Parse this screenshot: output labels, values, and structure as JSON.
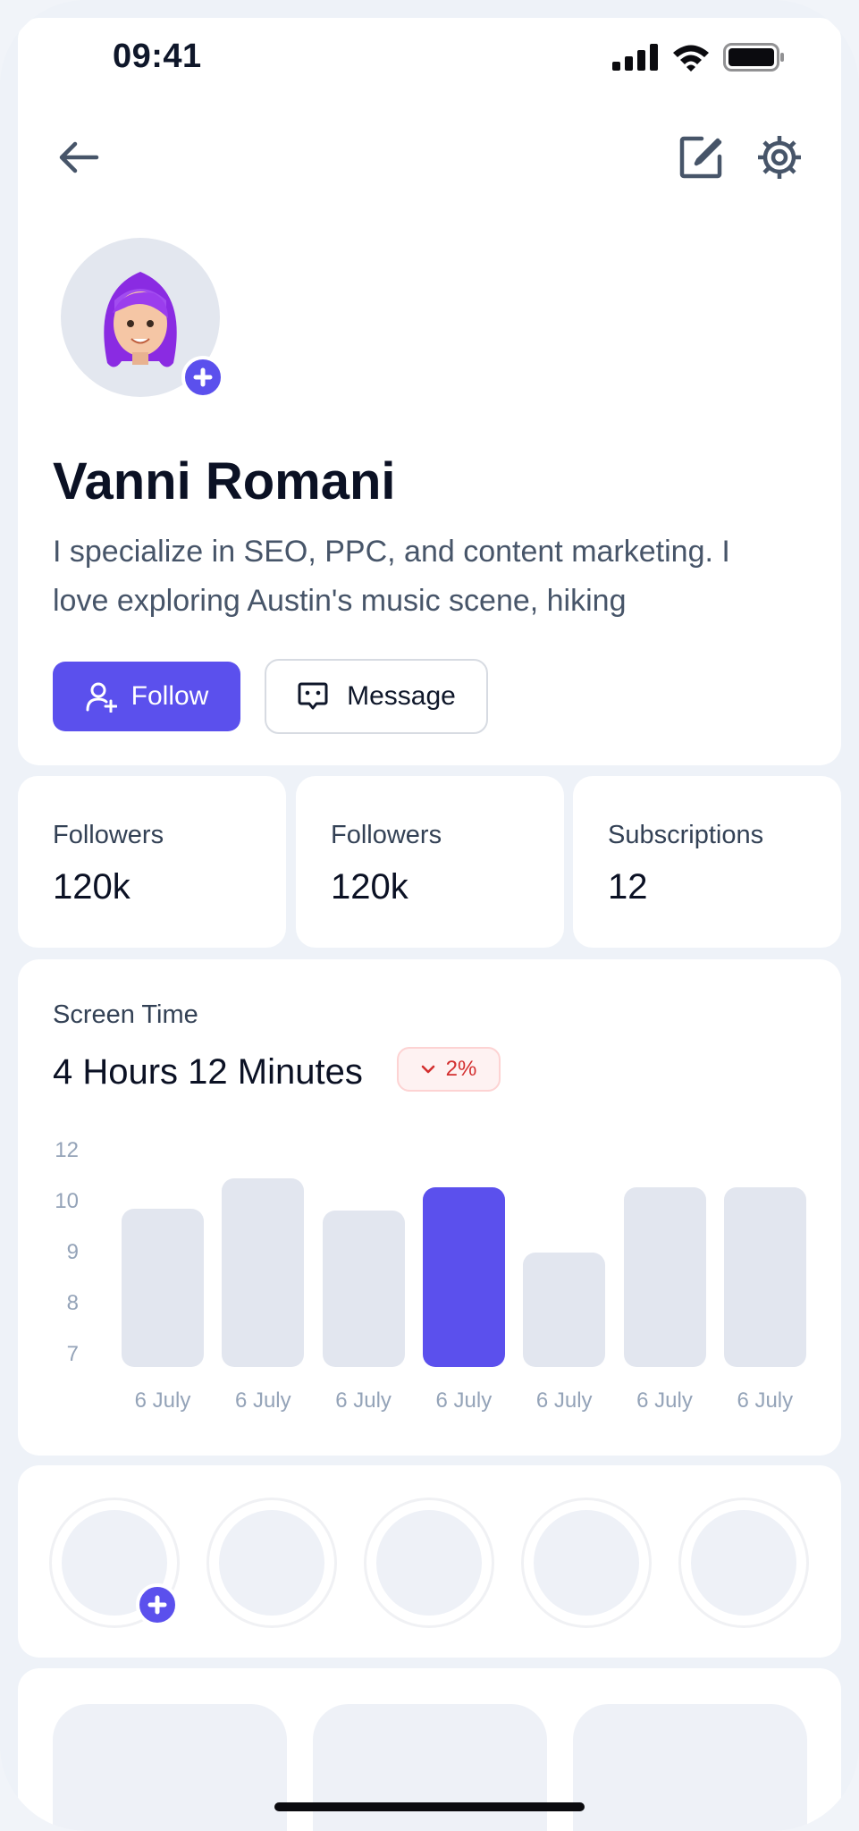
{
  "status_bar": {
    "time": "09:41",
    "icons": [
      "signal-icon",
      "wifi-icon",
      "battery-icon"
    ]
  },
  "header": {
    "icons": [
      "back-arrow-icon",
      "edit-icon",
      "settings-icon"
    ]
  },
  "profile": {
    "name": "Vanni Romani",
    "bio_line1": "I specialize in SEO, PPC, and content marketing. I",
    "bio_line2": "love exploring Austin's music scene, hiking",
    "follow_label": "Follow",
    "message_label": "Message"
  },
  "stats": [
    {
      "label": "Followers",
      "value": "120k"
    },
    {
      "label": "Followers",
      "value": "120k"
    },
    {
      "label": "Subscriptions",
      "value": "12"
    }
  ],
  "screen_time": {
    "label": "Screen Time",
    "value": "4 Hours 12 Minutes",
    "change": "2%"
  },
  "chart_data": {
    "type": "bar",
    "categories": [
      "6 July",
      "6 July",
      "6 July",
      "6 July",
      "6 July",
      "6 July",
      "6 July"
    ],
    "values": [
      10.0,
      10.7,
      9.95,
      10.5,
      9.0,
      10.5,
      10.5
    ],
    "highlighted_index": 3,
    "yticks": [
      "12",
      "10",
      "9",
      "8",
      "7"
    ],
    "colors": {
      "bar": "#e2e6ef",
      "active": "#5b50ed"
    }
  },
  "colors": {
    "accent": "#5b50ed",
    "badge_text": "#d32f2f"
  }
}
